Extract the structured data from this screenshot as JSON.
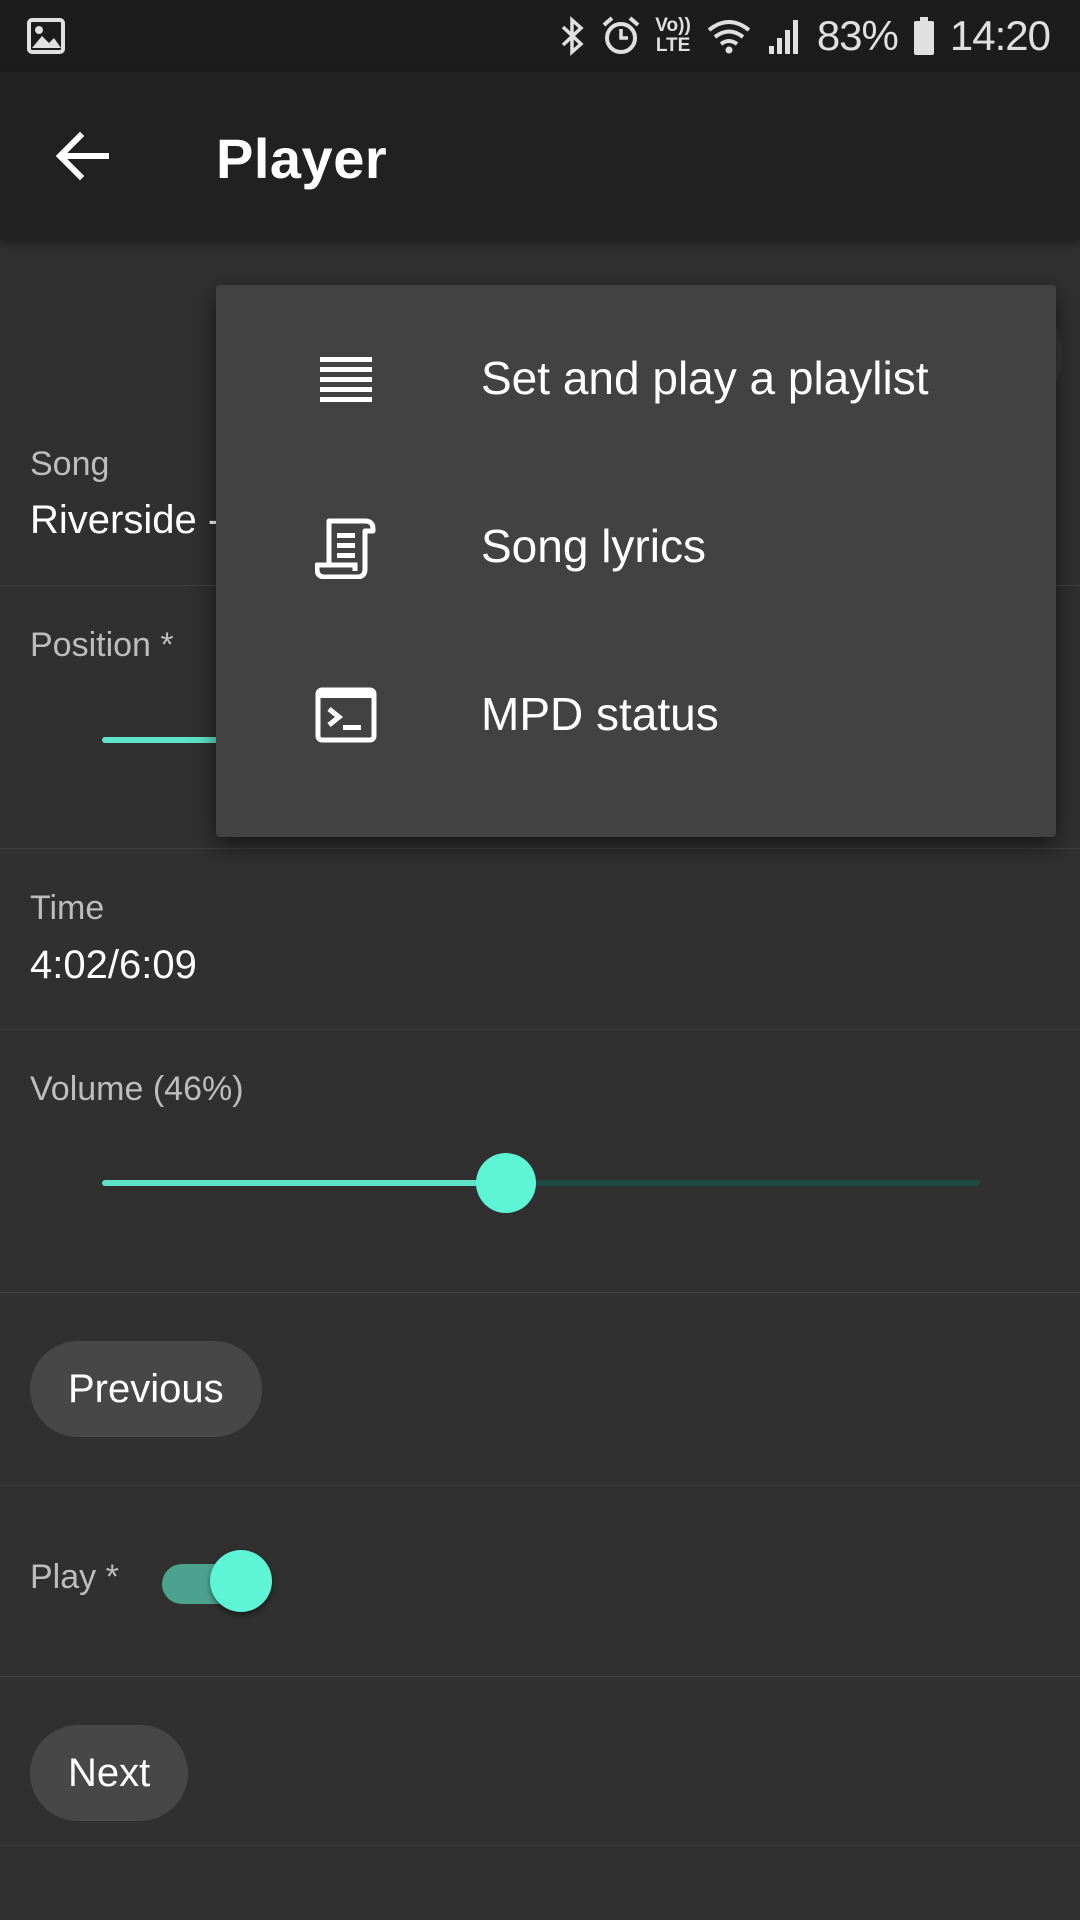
{
  "status_bar": {
    "battery": "83%",
    "time": "14:20",
    "volte_line1": "Vo))",
    "volte_line2": "LTE"
  },
  "toolbar": {
    "title": "Player"
  },
  "song": {
    "label": "Song",
    "value": "Riverside - "
  },
  "position": {
    "label": "Position *"
  },
  "time": {
    "label": "Time",
    "value": "4:02/6:09"
  },
  "volume": {
    "label": "Volume (46%)",
    "level": 0.46
  },
  "controls": {
    "previous_label": "Previous",
    "play_label": "Play *",
    "play_on": true,
    "next_label": "Next"
  },
  "menu": {
    "items": [
      {
        "label": "Set and play a playlist",
        "icon": "playlist-icon"
      },
      {
        "label": "Song lyrics",
        "icon": "lyrics-icon"
      },
      {
        "label": "MPD status",
        "icon": "terminal-icon"
      }
    ]
  },
  "colors": {
    "accent": "#5ef5d6",
    "background": "#303030",
    "toolbar": "#212121",
    "menu": "#424242"
  }
}
